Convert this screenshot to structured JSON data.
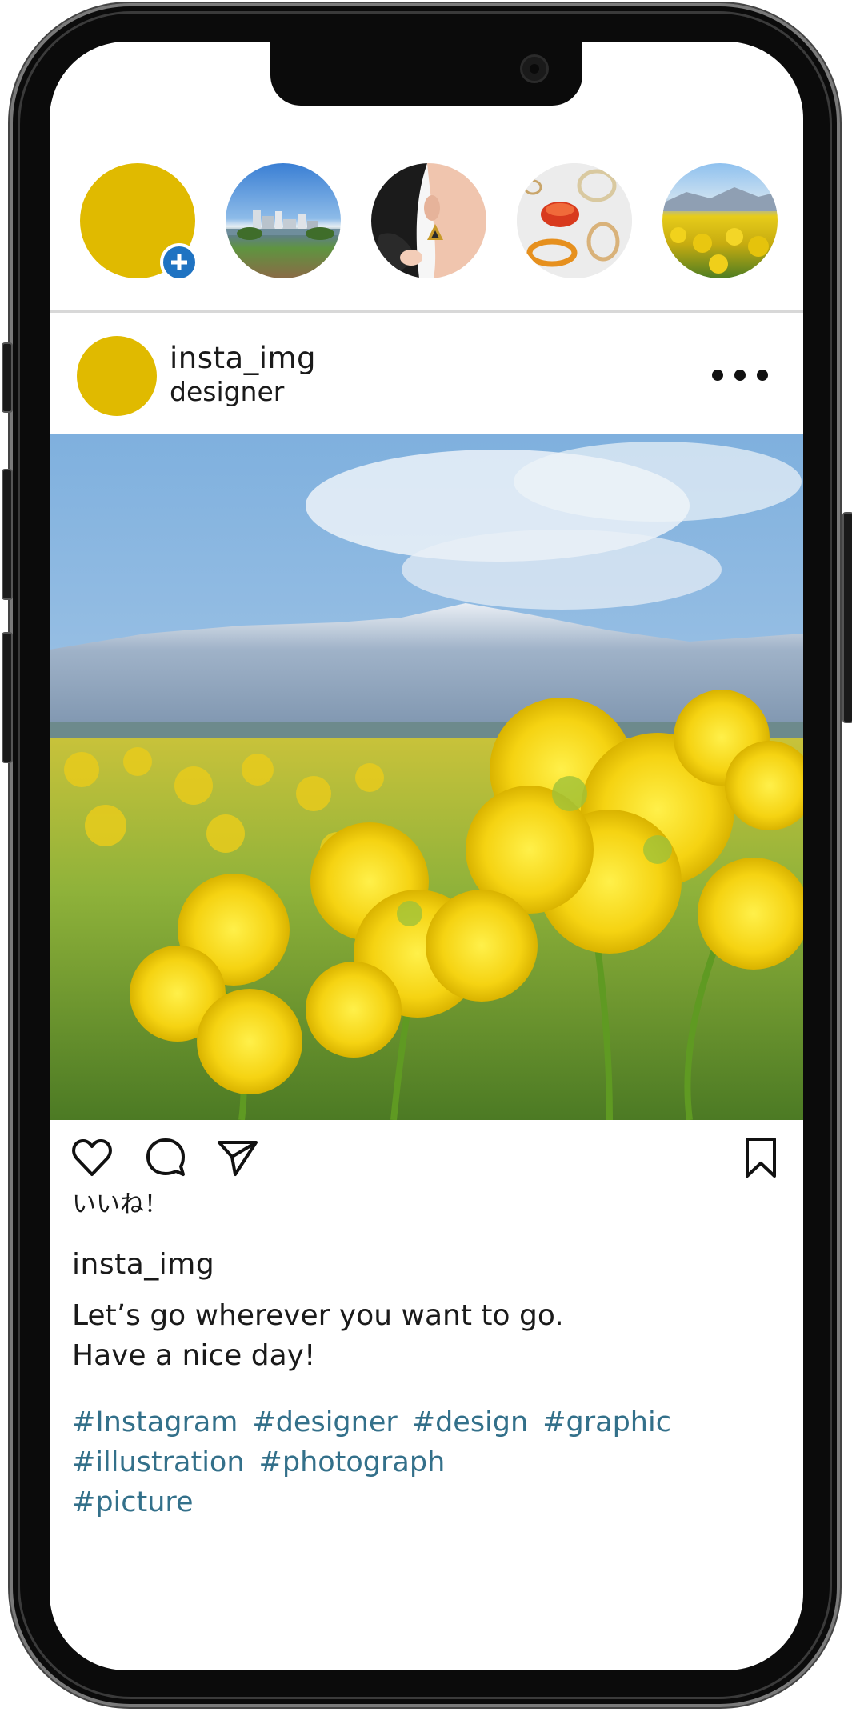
{
  "stories": [
    {
      "name": "own-story",
      "color": "#e0ba00",
      "badge_icon": "plus-icon"
    },
    {
      "name": "city-skyline"
    },
    {
      "name": "earring-portrait"
    },
    {
      "name": "rings-and-bangles"
    },
    {
      "name": "rapeseed-field"
    }
  ],
  "post": {
    "username": "insta_img",
    "subtitle": "designer",
    "more_icon": "more-dots-icon",
    "photo": "rapeseed-flowers-mountains",
    "actions": {
      "like_icon": "heart-icon",
      "comment_icon": "comment-icon",
      "share_icon": "send-icon",
      "save_icon": "bookmark-icon"
    },
    "like_label": "いいね！",
    "caption_user": "insta_img",
    "caption_lines": [
      "Let’s go wherever you want to go.",
      "Have a nice day!"
    ],
    "hashtags": [
      [
        "#Instagram",
        "#designer",
        "#design",
        "#graphic"
      ],
      [
        "#illustration",
        "#photograph"
      ],
      [
        "#picture"
      ]
    ]
  },
  "colors": {
    "accent_yellow": "#e0ba00",
    "badge_blue": "#1f73c2",
    "hashtag": "#33708a",
    "text": "#1a1a1a",
    "frame": "#0b0b0b"
  }
}
